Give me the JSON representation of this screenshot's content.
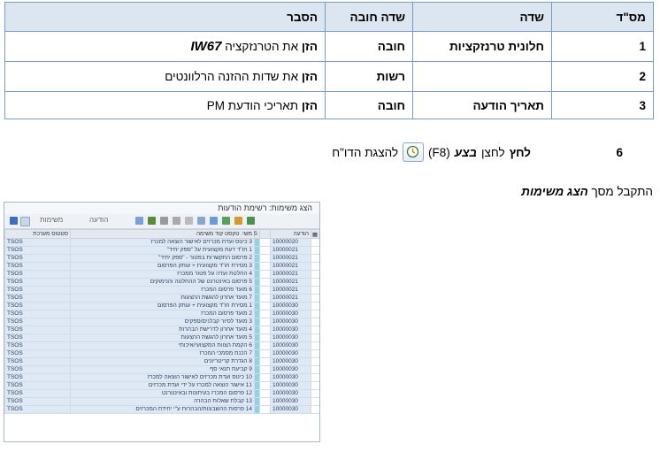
{
  "table": {
    "headers": {
      "num": "מס\"ד",
      "field": "שדה",
      "required": "שדה חובה",
      "explanation": "הסבר"
    },
    "rows": [
      {
        "num": "1",
        "field": "חלונית טרנזקציות",
        "required": "חובה",
        "expl_bold": "הזן",
        "expl_text": " את הטרנזקציה ",
        "expl_code": "IW67"
      },
      {
        "num": "2",
        "field": "",
        "required": "רשות",
        "expl_bold": "הזן",
        "expl_text": " את שדות ההזנה הרלוונטים",
        "expl_code": ""
      },
      {
        "num": "3",
        "field": "תאריך הודעה",
        "required": "חובה",
        "expl_bold": "הזן",
        "expl_text": " תאריכי הודעת PM",
        "expl_code": ""
      }
    ]
  },
  "step6": {
    "num": "6",
    "press": "לחץ",
    "lachtzan": " לחצן ",
    "execute": "בצע",
    "key": "(F8)",
    "suffix": "להצגת הדו\"ח"
  },
  "note": {
    "prefix": "התקבל מסך ",
    "screen": "הצג משימות"
  },
  "sap": {
    "title": "הצג משימות: רשימת הודעות",
    "toolbar": {
      "notification": "הודעה",
      "tasks": "משימות"
    },
    "columns": {
      "notification": "הודעה",
      "status": "S",
      "task": "משי. טקסט קוד משימה",
      "system_status": "סטטוס מערכת"
    },
    "rows": [
      {
        "notif": "10000020",
        "task": "3",
        "text": "כינוס ועדת מכרזים לאישור הוצאה למכרז",
        "sys": "TSOS"
      },
      {
        "notif": "10000021",
        "task": "1",
        "text": "חו\"ד דעת מקצועית על \"ספק יחיד\"",
        "sys": "TSOS"
      },
      {
        "notif": "10000021",
        "task": "2",
        "text": "פרסום התקשרות בפטור - \"ספק יחיד\"",
        "sys": "TSOS"
      },
      {
        "notif": "10000021",
        "task": "3",
        "text": "מסירת חו\"ד מקצועית + עותק הפרסום",
        "sys": "TSOS"
      },
      {
        "notif": "10000021",
        "task": "4",
        "text": "החלטת ועדה על פטור ממכרז",
        "sys": "TSOS"
      },
      {
        "notif": "10000021",
        "task": "5",
        "text": "פרסום באינטרנט של ההחלטה והנימוקים",
        "sys": "TSOS"
      },
      {
        "notif": "10000021",
        "task": "6",
        "text": "מועד פרסום המכרז",
        "sys": "TSOS"
      },
      {
        "notif": "10000021",
        "task": "7",
        "text": "מועד אחרון להגשת ההצעות",
        "sys": "TSOS"
      },
      {
        "notif": "10000030",
        "task": "1",
        "text": "מסירת חו\"ד מקצועית + עותק הפרסום",
        "sys": "TSOS"
      },
      {
        "notif": "10000030",
        "task": "2",
        "text": "מועד פרסום המכרז",
        "sys": "TSOS"
      },
      {
        "notif": "10000030",
        "task": "3",
        "text": "מועד לסיור קבלנים/ספקים",
        "sys": "TSOS"
      },
      {
        "notif": "10000030",
        "task": "4",
        "text": "מועד אחרון לדרישת הבהרות",
        "sys": "TSOS"
      },
      {
        "notif": "10000030",
        "task": "5",
        "text": "מועד אחרון להגשת ההצעות",
        "sys": "TSOS"
      },
      {
        "notif": "10000030",
        "task": "6",
        "text": "הקמת הצוות המקצועי/איכותי",
        "sys": "TSOS"
      },
      {
        "notif": "10000030",
        "task": "7",
        "text": "הכנת מסמכי המכרז",
        "sys": "TSOS"
      },
      {
        "notif": "10000030",
        "task": "8",
        "text": "הגדרת קריטריונים",
        "sys": "TSOS"
      },
      {
        "notif": "10000030",
        "task": "9",
        "text": "קביעת תנאי סף",
        "sys": "TSOS"
      },
      {
        "notif": "10000030",
        "task": "10",
        "text": "כינוס ועדת מכרזים לאישור הוצאה למכרז",
        "sys": "TSOS"
      },
      {
        "notif": "10000030",
        "task": "11",
        "text": "אישור הוצאה למכרז על ידי ועדת מכרזים",
        "sys": "TSOS"
      },
      {
        "notif": "10000030",
        "task": "12",
        "text": "פרסום המכרז בעיתונות ובאינטרנט",
        "sys": "TSOS"
      },
      {
        "notif": "10000030",
        "task": "13",
        "text": "קבלת שאלות הבהרה",
        "sys": "TSOS"
      },
      {
        "notif": "10000030",
        "task": "14",
        "text": "פרסות ההשבונות/הבהרות ע\"י יחידת המכרזים",
        "sys": "TSOS"
      }
    ]
  }
}
